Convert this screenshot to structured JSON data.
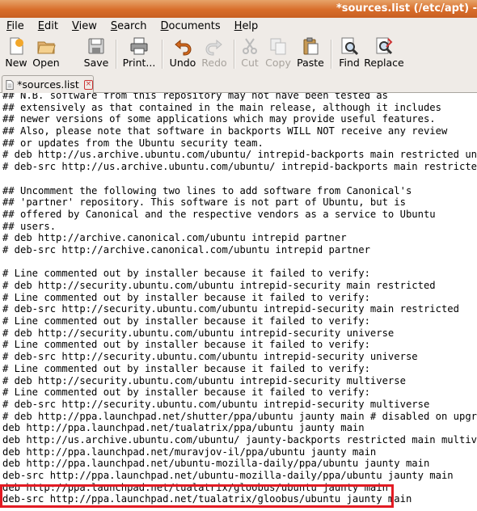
{
  "window": {
    "title": "*sources.list (/etc/apt) -"
  },
  "menu": [
    "File",
    "Edit",
    "View",
    "Search",
    "Documents",
    "Help"
  ],
  "menu_mnemonics": [
    "F",
    "E",
    "V",
    "S",
    "D",
    "H"
  ],
  "toolbar": {
    "new": "New",
    "open": "Open",
    "save": "Save",
    "print": "Print...",
    "undo": "Undo",
    "redo": "Redo",
    "cut": "Cut",
    "copy": "Copy",
    "paste": "Paste",
    "find": "Find",
    "replace": "Replace"
  },
  "tab": {
    "label": "*sources.list"
  },
  "editor": {
    "lines": [
      "## N.B. software from this repository may not have been tested as",
      "## extensively as that contained in the main release, although it includes",
      "## newer versions of some applications which may provide useful features.",
      "## Also, please note that software in backports WILL NOT receive any review",
      "## or updates from the Ubuntu security team.",
      "# deb http://us.archive.ubuntu.com/ubuntu/ intrepid-backports main restricted univers",
      "# deb-src http://us.archive.ubuntu.com/ubuntu/ intrepid-backports main restricted uni",
      "",
      "## Uncomment the following two lines to add software from Canonical's",
      "## 'partner' repository. This software is not part of Ubuntu, but is",
      "## offered by Canonical and the respective vendors as a service to Ubuntu",
      "## users.",
      "# deb http://archive.canonical.com/ubuntu intrepid partner",
      "# deb-src http://archive.canonical.com/ubuntu intrepid partner",
      "",
      "# Line commented out by installer because it failed to verify:",
      "# deb http://security.ubuntu.com/ubuntu intrepid-security main restricted",
      "# Line commented out by installer because it failed to verify:",
      "# deb-src http://security.ubuntu.com/ubuntu intrepid-security main restricted",
      "# Line commented out by installer because it failed to verify:",
      "# deb http://security.ubuntu.com/ubuntu intrepid-security universe",
      "# Line commented out by installer because it failed to verify:",
      "# deb-src http://security.ubuntu.com/ubuntu intrepid-security universe",
      "# Line commented out by installer because it failed to verify:",
      "# deb http://security.ubuntu.com/ubuntu intrepid-security multiverse",
      "# Line commented out by installer because it failed to verify:",
      "# deb-src http://security.ubuntu.com/ubuntu intrepid-security multiverse",
      "# deb http://ppa.launchpad.net/shutter/ppa/ubuntu jaunty main # disabled on upgrade t",
      "deb http://ppa.launchpad.net/tualatrix/ppa/ubuntu jaunty main",
      "deb http://us.archive.ubuntu.com/ubuntu/ jaunty-backports restricted main multiverse",
      "deb http://ppa.launchpad.net/muravjov-il/ppa/ubuntu jaunty main",
      "deb http://ppa.launchpad.net/ubuntu-mozilla-daily/ppa/ubuntu jaunty main",
      "deb-src http://ppa.launchpad.net/ubuntu-mozilla-daily/ppa/ubuntu jaunty main",
      "deb http://ppa.launchpad.net/tualatrix/gloobus/ubuntu jaunty main",
      "deb-src http://ppa.launchpad.net/tualatrix/gloobus/ubuntu jaunty main"
    ]
  },
  "colors": {
    "titlebar": "#d86d2a",
    "highlight": "#e31b23"
  },
  "icons": [
    "new-icon",
    "open-icon",
    "save-icon",
    "print-icon",
    "undo-icon",
    "redo-icon",
    "cut-icon",
    "copy-icon",
    "paste-icon",
    "find-icon",
    "replace-icon",
    "document-icon",
    "close-icon"
  ]
}
